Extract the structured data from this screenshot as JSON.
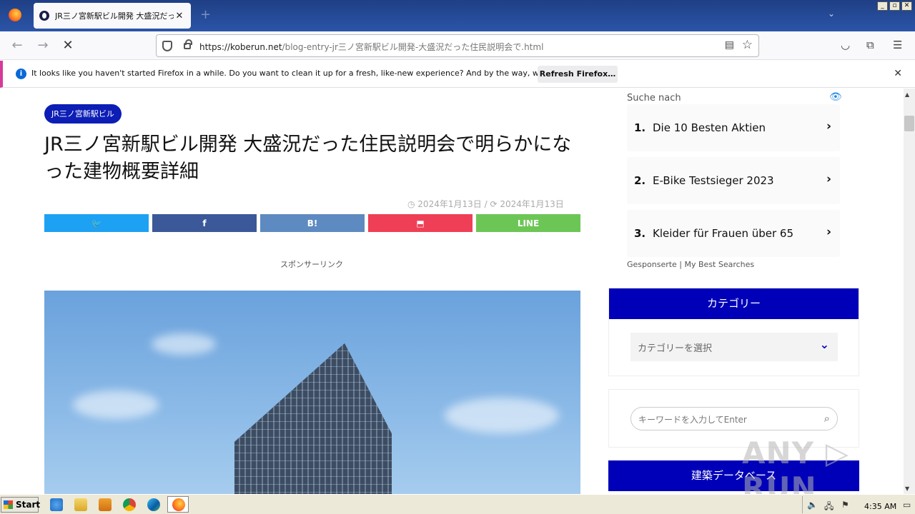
{
  "browser": {
    "tab_title": "JR三ノ宮新駅ビル開発 大盛況だった住民説明会で明らかになった建物概要詳細",
    "tab_close": "✕",
    "new_tab": "+",
    "tab_list": "⌄",
    "window_controls": [
      "_",
      "▫",
      "✕"
    ],
    "url_host": "https://koberun.net",
    "url_path": "/blog-entry-jr三ノ宮新駅ビル開発-大盛況だった住民説明会で.html",
    "nav": {
      "back": "←",
      "forward": "→",
      "stop": "✕"
    },
    "toolbar_icons": [
      "pocket-icon",
      "extensions-icon",
      "menu-icon"
    ]
  },
  "notification": {
    "icon": "i",
    "text": "It looks like you haven't started Firefox in a while. Do you want to clean it up for a fresh, like-new experience? And by the way, welcome back!",
    "button": "Refresh Firefox…",
    "close": "✕"
  },
  "article": {
    "category": "JR三ノ宮新駅ビル",
    "title": "JR三ノ宮新駅ビル開発 大盛況だった住民説明会で明らかになった建物概要詳細",
    "published": "2024年1月13日",
    "updated": "2024年1月13日",
    "date_separator": "/",
    "share": [
      {
        "label": "🐦",
        "name": "share-twitter",
        "color": "#1da1f2"
      },
      {
        "label": "f",
        "name": "share-facebook",
        "color": "#3b5998"
      },
      {
        "label": "B!",
        "name": "share-hatena",
        "color": "#5d8ac1"
      },
      {
        "label": "⬒",
        "name": "share-pocket",
        "color": "#ef3f56"
      },
      {
        "label": "LINE",
        "name": "share-line",
        "color": "#6cc655"
      }
    ],
    "sponsor_label": "スポンサーリンク"
  },
  "sidebar": {
    "search_label": "Suche nach",
    "ads": [
      {
        "num": "1.",
        "text": "Die 10 Besten Aktien"
      },
      {
        "num": "2.",
        "text": "E-Bike Testsieger 2023"
      },
      {
        "num": "3.",
        "text": "Kleider für Frauen über 65"
      }
    ],
    "ad_chevron": "›",
    "ad_footer": "Gesponserte | My Best Searches",
    "category_widget": {
      "title": "カテゴリー",
      "select_placeholder": "カテゴリーを選択",
      "chevron": "⌄"
    },
    "search_widget": {
      "placeholder": "キーワードを入力してEnter",
      "icon": "🔍"
    },
    "db_widget": {
      "title": "建築データベース"
    }
  },
  "watermark": "ANY ▷ RUN",
  "taskbar": {
    "start_label": "Start",
    "clock": "4:35 AM"
  }
}
